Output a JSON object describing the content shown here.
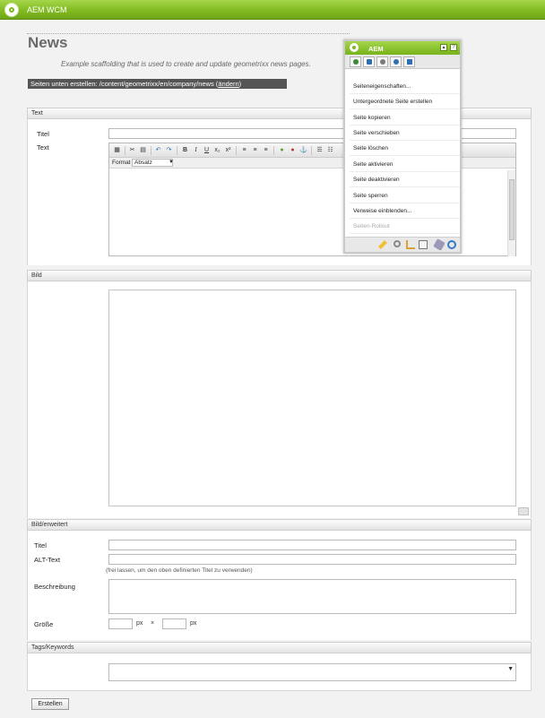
{
  "app": {
    "title": "AEM WCM"
  },
  "page": {
    "title": "News",
    "subtitle": "Example scaffolding that is used to create and update geometrixx news pages.",
    "create_below_label": "Seiten unten erstellen:",
    "create_below_path": "/content/geometrixx/en/company/news",
    "change_link": "ändern"
  },
  "sections": {
    "text": {
      "header": "Text",
      "title_label": "Titel",
      "text_label": "Text",
      "format_label": "Format",
      "format_value": "Absatz"
    },
    "image": {
      "header": "Bild"
    },
    "image_advanced": {
      "header": "Bild/erweitert",
      "title_label": "Titel",
      "alt_label": "ALT-Text",
      "alt_hint": "(frei lassen, um den oben definierten Titel zu verwenden)",
      "description_label": "Beschreibung",
      "size_label": "Größe",
      "unit": "px",
      "times": "×"
    },
    "tags": {
      "header": "Tags/Keywords"
    }
  },
  "actions": {
    "create_button": "Erstellen"
  },
  "sidekick": {
    "title": "AEM",
    "items": [
      "Seiteneigenschaften...",
      "Untergeordnete Seite erstellen",
      "Seite kopieren",
      "Seite verschieben",
      "Seite löschen",
      "Seite aktivieren",
      "Seite deaktivieren",
      "Seite sperren",
      "Verweise einblenden...",
      "Seiten-Rollout"
    ]
  },
  "colors": {
    "brand": "#7fb81f",
    "bar": "#555555"
  }
}
